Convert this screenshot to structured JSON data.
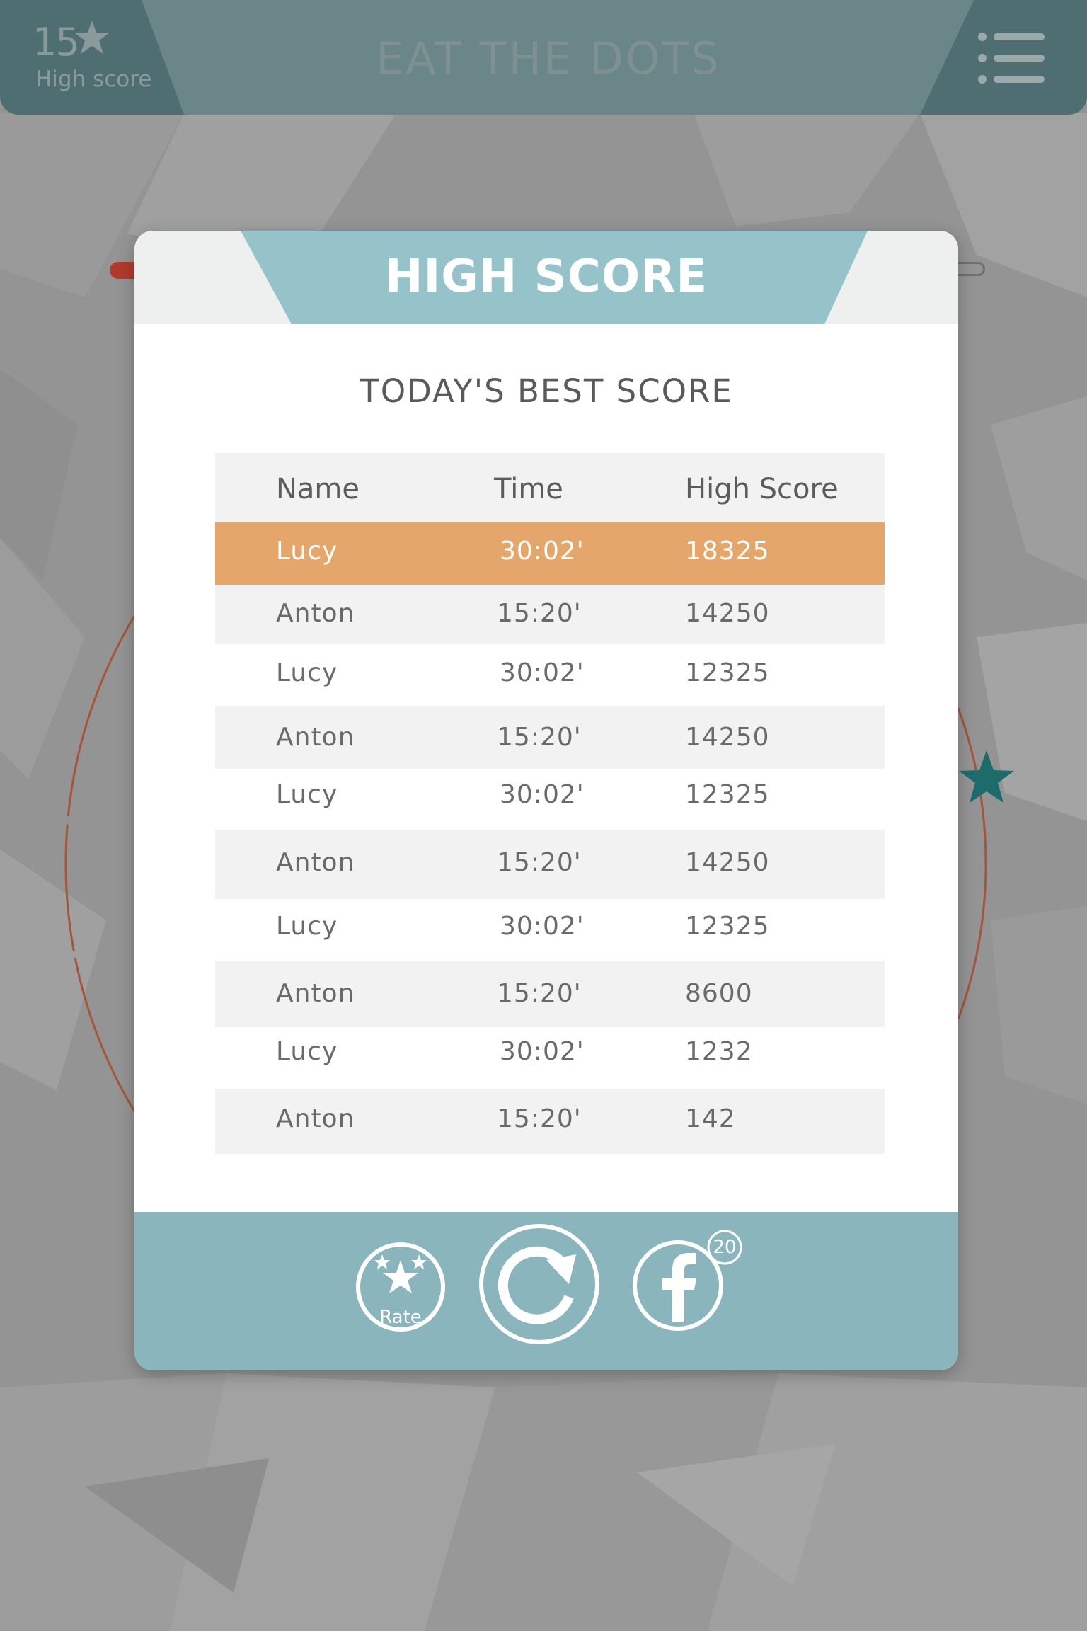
{
  "topbar": {
    "high_score_value": "15",
    "high_score_label": "High score",
    "title": "EAT THE DOTS",
    "star_icon": "star-icon",
    "menu_icon": "list-menu-icon"
  },
  "modal": {
    "title": "HIGH SCORE",
    "subtitle": "TODAY'S BEST SCORE",
    "table": {
      "headers": [
        "Name",
        "Time",
        "High Score"
      ],
      "rows": [
        {
          "name": "Lucy",
          "time": "30:02'",
          "score": "18325"
        },
        {
          "name": "Anton",
          "time": "15:20'",
          "score": "14250"
        },
        {
          "name": "Lucy",
          "time": "30:02'",
          "score": "12325"
        },
        {
          "name": "Anton",
          "time": "15:20'",
          "score": "14250"
        },
        {
          "name": "Lucy",
          "time": "30:02'",
          "score": "12325"
        },
        {
          "name": "Anton",
          "time": "15:20'",
          "score": "14250"
        },
        {
          "name": "Lucy",
          "time": "30:02'",
          "score": "12325"
        },
        {
          "name": "Anton",
          "time": "15:20'",
          "score": "8600"
        },
        {
          "name": "Lucy",
          "time": "30:02'",
          "score": "1232"
        },
        {
          "name": "Anton",
          "time": "15:20'",
          "score": "142"
        }
      ]
    },
    "footer": {
      "rate_label": "Rate",
      "rate_icon": "rate-stars-icon",
      "replay_icon": "replay-icon",
      "facebook_icon": "facebook-icon",
      "facebook_badge": "20"
    }
  },
  "colors": {
    "topbar": "#4f6e72",
    "header_band": "#96c3c9",
    "footer": "#8ab5bc",
    "highlight_row": "#e4a66b",
    "shaded_row": "#f2f2f2",
    "background": "#949494",
    "ring": "#a5553c",
    "scene_star": "#1e6b6c"
  }
}
